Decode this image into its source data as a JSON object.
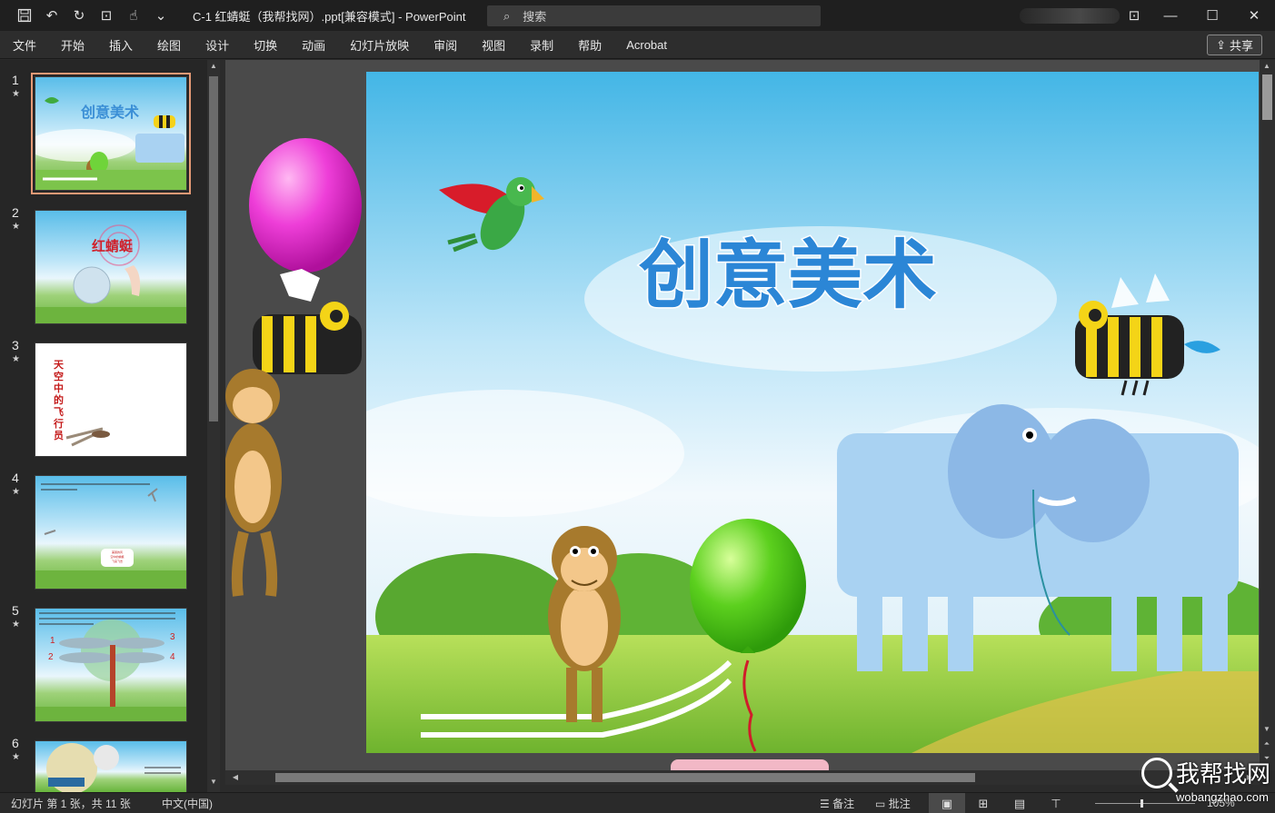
{
  "titlebar": {
    "doc_title": "C-1 红蜻蜓（我帮找网）.ppt[兼容模式]  -  PowerPoint",
    "search_placeholder": "搜索"
  },
  "menu": [
    "文件",
    "开始",
    "插入",
    "绘图",
    "设计",
    "切换",
    "动画",
    "幻灯片放映",
    "审阅",
    "视图",
    "录制",
    "帮助",
    "Acrobat"
  ],
  "share_label": "共享",
  "slides": [
    {
      "num": "1",
      "star": "★",
      "title": "创意美术"
    },
    {
      "num": "2",
      "star": "★",
      "title": "红蜻蜓"
    },
    {
      "num": "3",
      "star": "★",
      "title": "天空中的飞行员"
    },
    {
      "num": "4",
      "star": "★",
      "bubble": "美丽的风\n空中的蜻蜓\n飞来飞去"
    },
    {
      "num": "5",
      "star": "★",
      "labels": [
        "1",
        "2",
        "3",
        "4"
      ]
    },
    {
      "num": "6",
      "star": "★"
    }
  ],
  "main_slide": {
    "title": "创意美术"
  },
  "status": {
    "slide_info": "幻灯片 第 1 张，共 11 张",
    "language": "中文(中国)",
    "notes": "备注",
    "comments": "批注",
    "zoom": "105%"
  },
  "watermark": {
    "main": "我帮找网",
    "sub": "wobangzhao.com"
  }
}
